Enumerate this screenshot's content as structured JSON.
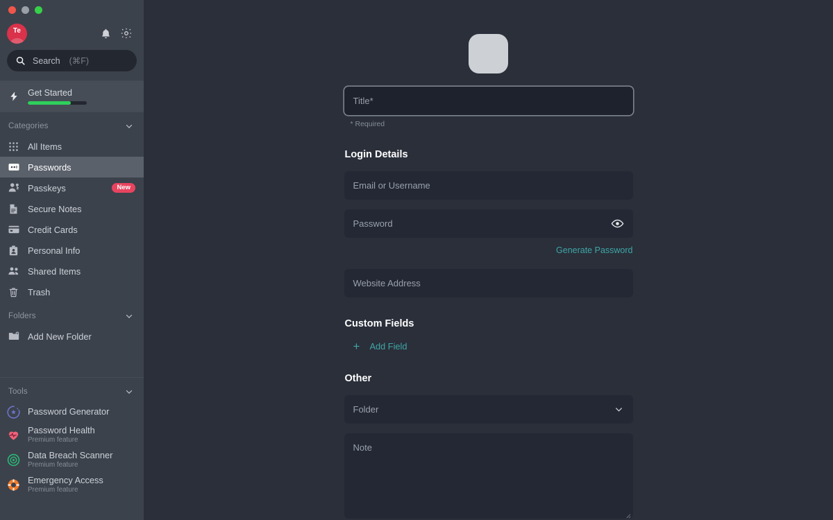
{
  "window": {
    "traffic_lights": [
      "close",
      "minimize",
      "maximize"
    ]
  },
  "sidebar": {
    "account": {
      "avatar_initials": "Te",
      "avatar_color": "#d9324a",
      "notifications_icon": "bell-icon",
      "settings_icon": "gear-icon"
    },
    "search": {
      "label": "Search",
      "shortcut": "(⌘F)",
      "icon": "search-icon"
    },
    "get_started": {
      "label": "Get Started",
      "icon": "bolt-icon",
      "progress_percent": 73,
      "progress_color": "#2fcf5c"
    },
    "categories": {
      "header": "Categories",
      "collapsed": false,
      "items": [
        {
          "label": "All Items",
          "icon": "grid-icon",
          "active": false,
          "badge": ""
        },
        {
          "label": "Passwords",
          "icon": "password-card-icon",
          "active": true,
          "badge": ""
        },
        {
          "label": "Passkeys",
          "icon": "person-key-icon",
          "active": false,
          "badge": "New"
        },
        {
          "label": "Secure Notes",
          "icon": "document-icon",
          "active": false,
          "badge": ""
        },
        {
          "label": "Credit Cards",
          "icon": "credit-card-icon",
          "active": false,
          "badge": ""
        },
        {
          "label": "Personal Info",
          "icon": "id-badge-icon",
          "active": false,
          "badge": ""
        },
        {
          "label": "Shared Items",
          "icon": "people-icon",
          "active": false,
          "badge": ""
        },
        {
          "label": "Trash",
          "icon": "trash-icon",
          "active": false,
          "badge": ""
        }
      ]
    },
    "folders": {
      "header": "Folders",
      "collapsed": false,
      "items": [
        {
          "label": "Add New Folder",
          "icon": "folder-plus-icon"
        }
      ]
    },
    "tools": {
      "header": "Tools",
      "collapsed": false,
      "items": [
        {
          "label": "Password Generator",
          "sublabel": "",
          "icon": "refresh-star-icon",
          "color": "#6b74c9"
        },
        {
          "label": "Password Health",
          "sublabel": "Premium feature",
          "icon": "heart-pulse-icon",
          "color": "#f0627a"
        },
        {
          "label": "Data Breach Scanner",
          "sublabel": "Premium feature",
          "icon": "target-icon",
          "color": "#2bb877"
        },
        {
          "label": "Emergency Access",
          "sublabel": "Premium feature",
          "icon": "life-ring-icon",
          "color": "#f07a2b"
        }
      ]
    }
  },
  "main": {
    "app_logo": "app-icon-placeholder",
    "title_field": {
      "placeholder": "Title*",
      "value": "",
      "focused": true
    },
    "required_note": "* Required",
    "login_section": {
      "title": "Login Details",
      "username_field": {
        "placeholder": "Email or Username",
        "value": ""
      },
      "password_field": {
        "placeholder": "Password",
        "value": "",
        "reveal_icon": "eye-icon"
      },
      "generate_link": "Generate Password",
      "website_field": {
        "placeholder": "Website Address",
        "value": ""
      }
    },
    "custom_fields_section": {
      "title": "Custom Fields",
      "add_label": "Add Field",
      "add_icon": "plus-icon"
    },
    "other_section": {
      "title": "Other",
      "folder_select": {
        "placeholder": "Folder",
        "value": "",
        "icon": "chevron-down-icon"
      },
      "note_field": {
        "placeholder": "Note",
        "value": ""
      }
    },
    "accent_color": "#3fa6a6"
  }
}
